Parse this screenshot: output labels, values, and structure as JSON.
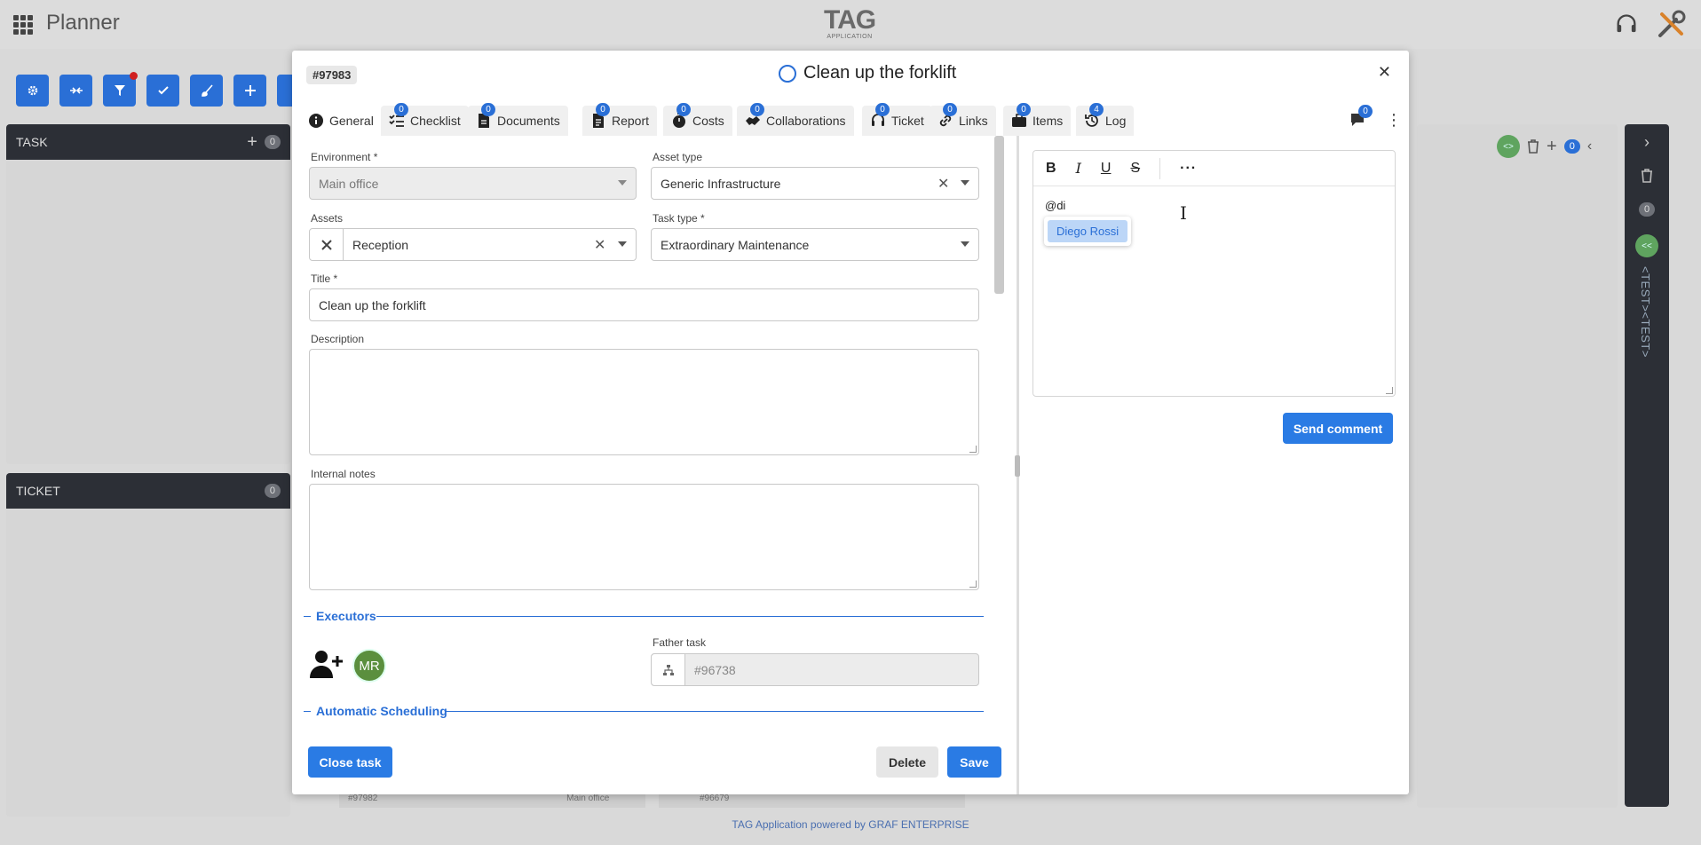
{
  "app": {
    "title": "Planner",
    "logo_main": "TAG",
    "logo_sub": "APPLICATION",
    "footer": "TAG Application powered by GRAF ENTERPRISE"
  },
  "background": {
    "task_panel": {
      "title": "TASK",
      "count": "0"
    },
    "ticket_panel": {
      "title": "TICKET",
      "count": "0"
    },
    "right_panel_count": "0",
    "rail_count": "0",
    "rail_text": "<TEST><TEST>",
    "card1_id": "#97982",
    "card1_env": "Main office",
    "card2_id": "#96679"
  },
  "modal": {
    "task_id": "#97983",
    "title": "Clean up the forklift",
    "tabs": [
      {
        "label": "General",
        "badge": ""
      },
      {
        "label": "Checklist",
        "badge": "0"
      },
      {
        "label": "Documents",
        "badge": "0"
      },
      {
        "label": "Report",
        "badge": "0"
      },
      {
        "label": "Costs",
        "badge": "0"
      },
      {
        "label": "Collaborations",
        "badge": "0"
      },
      {
        "label": "Ticket",
        "badge": "0"
      },
      {
        "label": "Links",
        "badge": "0"
      },
      {
        "label": "Items",
        "badge": "0"
      },
      {
        "label": "Log",
        "badge": "4"
      }
    ],
    "comments_badge": "0",
    "form": {
      "environment_label": "Environment *",
      "environment_value": "Main office",
      "asset_type_label": "Asset type",
      "asset_type_value": "Generic Infrastructure",
      "assets_label": "Assets",
      "assets_value": "Reception",
      "task_type_label": "Task type *",
      "task_type_value": "Extraordinary Maintenance",
      "title_label": "Title *",
      "title_value": "Clean up the forklift",
      "description_label": "Description",
      "internal_notes_label": "Internal notes",
      "executors_section": "Executors",
      "executor_initials": "MR",
      "father_task_label": "Father task",
      "father_task_placeholder": "#96738",
      "auto_scheduling_section": "Automatic Scheduling"
    },
    "buttons": {
      "close_task": "Close task",
      "delete": "Delete",
      "save": "Save",
      "send_comment": "Send comment"
    },
    "comment": {
      "typed_text": "@di",
      "mention_suggestion": "Diego Rossi"
    }
  }
}
